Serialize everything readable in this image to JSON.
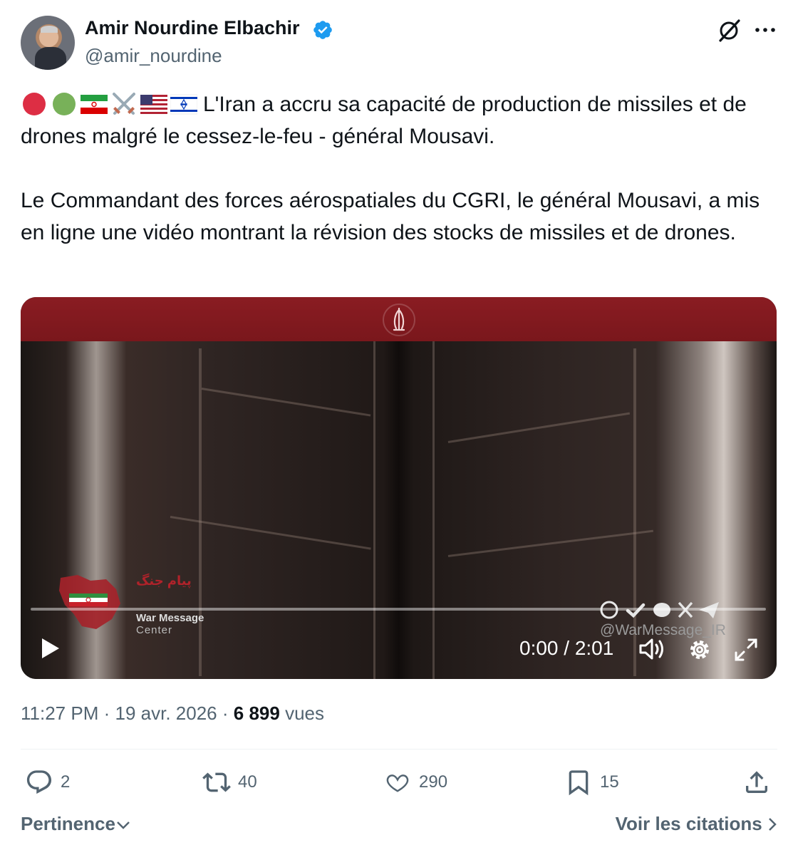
{
  "author": {
    "display_name": "Amir Nourdine Elbachir",
    "handle": "@amir_nourdine",
    "verified": true
  },
  "header_icons": [
    "grok-icon",
    "more-icon"
  ],
  "tweet": {
    "emojis": [
      "red-circle",
      "green-circle",
      "iran-flag",
      "crossed-swords",
      "us-flag",
      "israel-flag"
    ],
    "paragraph1": "L'Iran a accru sa capacité de production de missiles et de drones malgré le cessez-le-feu - général Mousavi.",
    "paragraph2": "Le Commandant des forces aérospatiales du CGRI, le général Mousavi, a mis en ligne une vidéo montrant la révision des stocks de missiles et de drones."
  },
  "video": {
    "time_display": "0:00 / 2:01",
    "progress": 0,
    "watermark_title": "War Message",
    "watermark_subtitle": "Center",
    "watermark_farsi": "پیام جنگ",
    "social_handle": "@WarMessage_IR",
    "banner_color": "#8a1c22"
  },
  "meta": {
    "time": "11:27 PM",
    "date": "19 avr. 2026",
    "views_count": "6 899",
    "views_label": "vues",
    "separator": "·"
  },
  "actions": {
    "replies": "2",
    "retweets": "40",
    "likes": "290",
    "bookmarks": "15"
  },
  "footer": {
    "sort_label": "Pertinence",
    "quotes_label": "Voir les citations"
  },
  "colors": {
    "accent_blue": "#1d9bf0",
    "text_primary": "#0f1419",
    "text_secondary": "#536471"
  }
}
